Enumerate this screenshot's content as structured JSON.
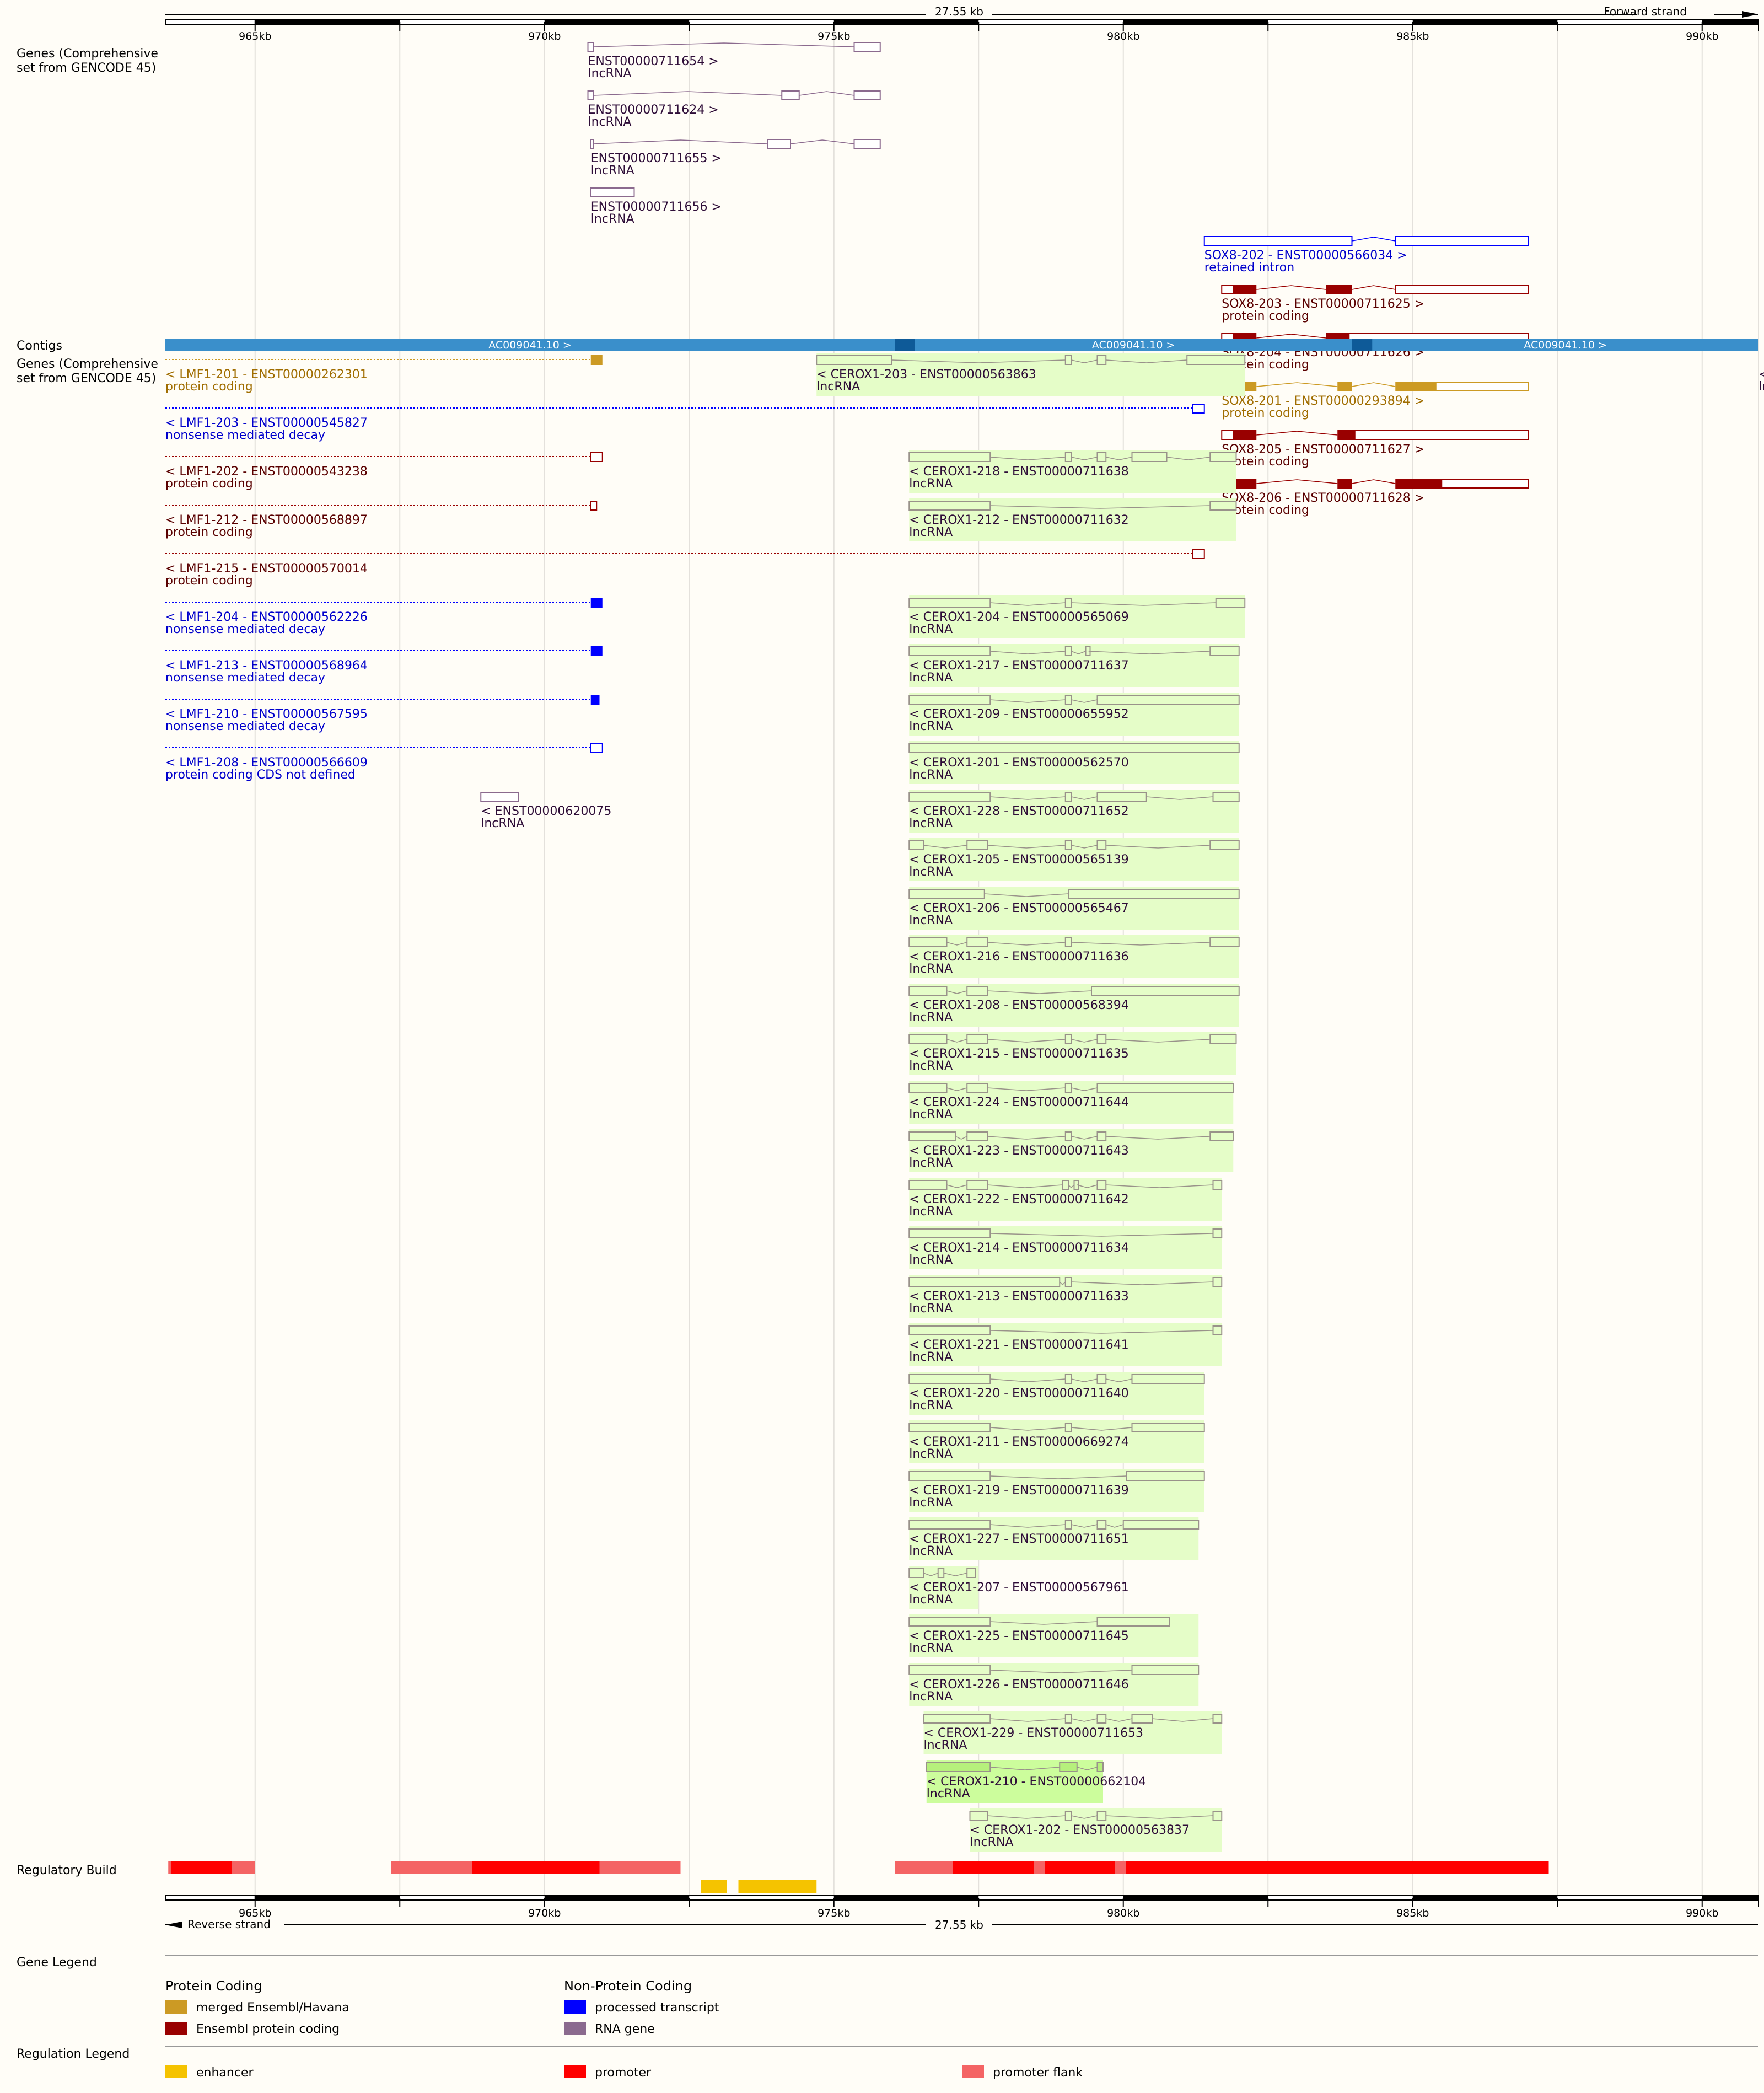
{
  "ruler": {
    "span_label": "27.55 kb",
    "forward_label": "Forward strand",
    "reverse_label": "Reverse strand",
    "ticks": [
      "965kb",
      "970kb",
      "975kb",
      "980kb",
      "985kb",
      "990kb"
    ]
  },
  "tracks": {
    "genes_top": "Genes (Comprehensive set from GENCODE 45)",
    "contigs": "Contigs",
    "genes_bottom": "Genes (Comprehensive set from GENCODE 45)",
    "regulatory": "Regulatory Build",
    "gene_legend": "Gene Legend",
    "regulation_legend": "Regulation Legend"
  },
  "contigs": [
    "AC009041.10 >",
    "AC009041.10 >",
    "AC009041.10 >"
  ],
  "colors": {
    "merged": "#cc9a24",
    "ensembl_coding": "#990000",
    "processed": "#0000ff",
    "rna_gene": "#8b6a8e",
    "lncrna_text": "#2e0d38",
    "contig": "#3a8fcb",
    "contig_dark": "#0e5a98",
    "enhancer": "#f5c300",
    "promoter": "#ff0000",
    "promoter_flank": "#f46464",
    "highlight": "#e5fdc8"
  },
  "genes_forward": [
    {
      "name": "ENST00000711654 >",
      "biotype": "lncRNA",
      "color": "#8b6a8e",
      "text": "#2e0d38",
      "exons": [
        [
          970.75,
          970.85,
          "o"
        ],
        [
          975.35,
          975.8,
          "o"
        ]
      ]
    },
    {
      "name": "ENST00000711624 >",
      "biotype": "lncRNA",
      "color": "#8b6a8e",
      "text": "#2e0d38",
      "exons": [
        [
          970.75,
          970.85,
          "o"
        ],
        [
          974.1,
          974.4,
          "o"
        ],
        [
          975.35,
          975.8,
          "o"
        ]
      ]
    },
    {
      "name": "ENST00000711655 >",
      "biotype": "lncRNA",
      "color": "#8b6a8e",
      "text": "#2e0d38",
      "exons": [
        [
          970.8,
          970.85,
          "o"
        ],
        [
          973.85,
          974.25,
          "o"
        ],
        [
          975.35,
          975.8,
          "o"
        ]
      ]
    },
    {
      "name": "ENST00000711656 >",
      "biotype": "lncRNA",
      "color": "#8b6a8e",
      "text": "#2e0d38",
      "exons": [
        [
          970.8,
          971.55,
          "o"
        ]
      ]
    },
    {
      "name": "SOX8-202 - ENST00000566034 >",
      "biotype": "retained intron",
      "color": "#0000ff",
      "text": "#0000cc",
      "exons": [
        [
          981.4,
          983.95,
          "o"
        ],
        [
          984.7,
          987.0,
          "o"
        ]
      ]
    },
    {
      "name": "SOX8-203 - ENST00000711625 >",
      "biotype": "protein coding",
      "color": "#990000",
      "text": "#5a0000",
      "exons": [
        [
          981.7,
          981.9,
          "o"
        ],
        [
          981.9,
          982.3,
          "f"
        ],
        [
          983.5,
          983.95,
          "f"
        ],
        [
          984.7,
          987.0,
          "o"
        ]
      ]
    },
    {
      "name": "SOX8-204 - ENST00000711626 >",
      "biotype": "protein coding",
      "color": "#990000",
      "text": "#5a0000",
      "exons": [
        [
          981.7,
          981.9,
          "o"
        ],
        [
          981.9,
          982.3,
          "f"
        ],
        [
          983.5,
          983.9,
          "f"
        ],
        [
          983.9,
          987.0,
          "o"
        ]
      ]
    },
    {
      "name": "SOX8-201 - ENST00000293894 >",
      "biotype": "protein coding",
      "color": "#cc9a24",
      "text": "#a06d00",
      "exons": [
        [
          981.7,
          981.9,
          "o"
        ],
        [
          981.9,
          982.3,
          "f"
        ],
        [
          983.7,
          983.95,
          "f"
        ],
        [
          984.7,
          985.4,
          "f"
        ],
        [
          985.4,
          987.0,
          "o"
        ]
      ]
    },
    {
      "name": "SOX8-205 - ENST00000711627 >",
      "biotype": "protein coding",
      "color": "#990000",
      "text": "#5a0000",
      "exons": [
        [
          981.7,
          981.9,
          "o"
        ],
        [
          981.9,
          982.3,
          "f"
        ],
        [
          983.7,
          984.0,
          "f"
        ],
        [
          984.0,
          987.0,
          "o"
        ]
      ]
    },
    {
      "name": "SOX8-206 - ENST00000711628 >",
      "biotype": "protein coding",
      "color": "#990000",
      "text": "#5a0000",
      "exons": [
        [
          981.7,
          981.9,
          "o"
        ],
        [
          981.9,
          982.3,
          "f"
        ],
        [
          983.7,
          983.95,
          "f"
        ],
        [
          984.7,
          985.5,
          "f"
        ],
        [
          985.5,
          987.0,
          "o"
        ]
      ]
    }
  ],
  "lmf1": [
    {
      "name": "< LMF1-201 - ENST00000262301",
      "biotype": "protein coding",
      "color": "#cc9a24",
      "text": "#a06d00",
      "exon": [
        970.8,
        971.0,
        "f"
      ]
    },
    {
      "name": "< LMF1-203 - ENST00000545827",
      "biotype": "nonsense mediated decay",
      "color": "#0000ff",
      "text": "#0000cc",
      "exon": [
        981.2,
        981.4,
        "o"
      ]
    },
    {
      "name": "< LMF1-202 - ENST00000543238",
      "biotype": "protein coding",
      "color": "#990000",
      "text": "#5a0000",
      "exon": [
        970.8,
        971.0,
        "o"
      ]
    },
    {
      "name": "< LMF1-212 - ENST00000568897",
      "biotype": "protein coding",
      "color": "#990000",
      "text": "#5a0000",
      "exon": [
        970.8,
        970.9,
        "o"
      ]
    },
    {
      "name": "< LMF1-215 - ENST00000570014",
      "biotype": "protein coding",
      "color": "#990000",
      "text": "#5a0000",
      "exon": [
        981.2,
        981.4,
        "o"
      ]
    },
    {
      "name": "< LMF1-204 - ENST00000562226",
      "biotype": "nonsense mediated decay",
      "color": "#0000ff",
      "text": "#0000cc",
      "exon": [
        970.8,
        971.0,
        "f"
      ]
    },
    {
      "name": "< LMF1-213 - ENST00000568964",
      "biotype": "nonsense mediated decay",
      "color": "#0000ff",
      "text": "#0000cc",
      "exon": [
        970.8,
        971.0,
        "f"
      ]
    },
    {
      "name": "< LMF1-210 - ENST00000567595",
      "biotype": "nonsense mediated decay",
      "color": "#0000ff",
      "text": "#0000cc",
      "exon": [
        970.8,
        970.95,
        "f"
      ]
    },
    {
      "name": "< LMF1-208 - ENST00000566609",
      "biotype": "protein coding CDS not defined",
      "color": "#0000ff",
      "text": "#0000cc",
      "exon": [
        970.8,
        971.0,
        "o"
      ]
    }
  ],
  "misc_reverse": [
    {
      "name": "< ENST00000620075",
      "biotype": "lncRNA",
      "row": 9,
      "start": 968.9,
      "end": 969.55
    },
    {
      "name": "< ENST",
      "biotype": "lncRNA",
      "row": 0,
      "start": 991.05,
      "end": 991.6
    }
  ],
  "cerox1": [
    {
      "name": "< CEROX1-203 - ENST00000563863",
      "biotype": "lncRNA",
      "row": 0,
      "start": 974.7,
      "end": 982.1,
      "exons": [
        [
          974.7,
          976.0
        ],
        [
          979.0,
          979.1
        ],
        [
          979.55,
          979.7
        ],
        [
          981.1,
          982.1
        ]
      ]
    },
    {
      "name": "< CEROX1-218 - ENST00000711638",
      "biotype": "lncRNA",
      "row": 2,
      "start": 976.3,
      "end": 981.95,
      "exons": [
        [
          976.3,
          977.7
        ],
        [
          979.0,
          979.1
        ],
        [
          979.55,
          979.7
        ],
        [
          980.15,
          980.75
        ],
        [
          981.5,
          981.95
        ]
      ]
    },
    {
      "name": "< CEROX1-212 - ENST00000711632",
      "biotype": "lncRNA",
      "row": 3,
      "start": 976.3,
      "end": 981.95,
      "exons": [
        [
          976.3,
          977.7
        ],
        [
          981.5,
          981.95
        ]
      ]
    },
    {
      "name": "< CEROX1-204 - ENST00000565069",
      "biotype": "lncRNA",
      "row": 5,
      "start": 976.3,
      "end": 982.1,
      "exons": [
        [
          976.3,
          977.7
        ],
        [
          979.0,
          979.1
        ],
        [
          981.6,
          982.1
        ]
      ]
    },
    {
      "name": "< CEROX1-217 - ENST00000711637",
      "biotype": "lncRNA",
      "row": 6,
      "start": 976.3,
      "end": 982.0,
      "exons": [
        [
          976.3,
          977.7
        ],
        [
          979.0,
          979.1
        ],
        [
          979.35,
          979.4
        ],
        [
          981.5,
          982.0
        ]
      ]
    },
    {
      "name": "< CEROX1-209 - ENST00000655952",
      "biotype": "lncRNA",
      "row": 7,
      "start": 976.3,
      "end": 982.0,
      "exons": [
        [
          976.3,
          977.7
        ],
        [
          979.0,
          979.1
        ],
        [
          979.55,
          982.0
        ]
      ]
    },
    {
      "name": "< CEROX1-201 - ENST00000562570",
      "biotype": "lncRNA",
      "row": 8,
      "start": 976.3,
      "end": 982.0,
      "exons": [
        [
          976.3,
          982.0
        ]
      ]
    },
    {
      "name": "< CEROX1-228 - ENST00000711652",
      "biotype": "lncRNA",
      "row": 9,
      "start": 976.3,
      "end": 982.0,
      "exons": [
        [
          976.3,
          977.7
        ],
        [
          979.0,
          979.1
        ],
        [
          979.55,
          980.4
        ],
        [
          981.55,
          982.0
        ]
      ]
    },
    {
      "name": "< CEROX1-205 - ENST00000565139",
      "biotype": "lncRNA",
      "row": 10,
      "start": 976.3,
      "end": 982.0,
      "exons": [
        [
          976.3,
          976.55
        ],
        [
          977.3,
          977.65
        ],
        [
          979.0,
          979.1
        ],
        [
          979.55,
          979.7
        ],
        [
          981.5,
          982.0
        ]
      ]
    },
    {
      "name": "< CEROX1-206 - ENST00000565467",
      "biotype": "lncRNA",
      "row": 11,
      "start": 976.3,
      "end": 982.0,
      "exons": [
        [
          976.3,
          977.6
        ],
        [
          979.05,
          982.0
        ]
      ]
    },
    {
      "name": "< CEROX1-216 - ENST00000711636",
      "biotype": "lncRNA",
      "row": 12,
      "start": 976.3,
      "end": 982.0,
      "exons": [
        [
          976.3,
          976.95
        ],
        [
          977.3,
          977.65
        ],
        [
          979.0,
          979.1
        ],
        [
          981.5,
          982.0
        ]
      ]
    },
    {
      "name": "< CEROX1-208 - ENST00000568394",
      "biotype": "lncRNA",
      "row": 13,
      "start": 976.3,
      "end": 982.0,
      "exons": [
        [
          976.3,
          976.95
        ],
        [
          977.3,
          977.65
        ],
        [
          979.45,
          982.0
        ]
      ]
    },
    {
      "name": "< CEROX1-215 - ENST00000711635",
      "biotype": "lncRNA",
      "row": 14,
      "start": 976.3,
      "end": 981.95,
      "exons": [
        [
          976.3,
          976.95
        ],
        [
          977.3,
          977.65
        ],
        [
          979.0,
          979.1
        ],
        [
          979.55,
          979.7
        ],
        [
          981.5,
          981.95
        ]
      ]
    },
    {
      "name": "< CEROX1-224 - ENST00000711644",
      "biotype": "lncRNA",
      "row": 15,
      "start": 976.3,
      "end": 981.9,
      "exons": [
        [
          976.3,
          976.95
        ],
        [
          977.3,
          977.65
        ],
        [
          979.0,
          979.1
        ],
        [
          979.55,
          981.9
        ]
      ]
    },
    {
      "name": "< CEROX1-223 - ENST00000711643",
      "biotype": "lncRNA",
      "row": 16,
      "start": 976.3,
      "end": 981.9,
      "exons": [
        [
          976.3,
          977.1
        ],
        [
          977.3,
          977.65
        ],
        [
          979.0,
          979.1
        ],
        [
          979.55,
          979.7
        ],
        [
          981.5,
          981.9
        ]
      ]
    },
    {
      "name": "< CEROX1-222 - ENST00000711642",
      "biotype": "lncRNA",
      "row": 17,
      "start": 976.3,
      "end": 981.7,
      "exons": [
        [
          976.3,
          976.95
        ],
        [
          977.3,
          977.65
        ],
        [
          978.95,
          979.05
        ],
        [
          979.15,
          979.2
        ],
        [
          979.55,
          979.7
        ],
        [
          981.55,
          981.7
        ]
      ]
    },
    {
      "name": "< CEROX1-214 - ENST00000711634",
      "biotype": "lncRNA",
      "row": 18,
      "start": 976.3,
      "end": 981.7,
      "exons": [
        [
          976.3,
          977.7
        ],
        [
          981.55,
          981.7
        ]
      ]
    },
    {
      "name": "< CEROX1-213 - ENST00000711633",
      "biotype": "lncRNA",
      "row": 19,
      "start": 976.3,
      "end": 981.7,
      "exons": [
        [
          976.3,
          978.9
        ],
        [
          979.0,
          979.1
        ],
        [
          981.55,
          981.7
        ]
      ]
    },
    {
      "name": "< CEROX1-221 - ENST00000711641",
      "biotype": "lncRNA",
      "row": 20,
      "start": 976.3,
      "end": 981.7,
      "exons": [
        [
          976.3,
          977.7
        ],
        [
          981.55,
          981.7
        ]
      ]
    },
    {
      "name": "< CEROX1-220 - ENST00000711640",
      "biotype": "lncRNA",
      "row": 21,
      "start": 976.3,
      "end": 981.4,
      "exons": [
        [
          976.3,
          977.7
        ],
        [
          979.0,
          979.1
        ],
        [
          979.55,
          979.7
        ],
        [
          980.15,
          981.4
        ]
      ]
    },
    {
      "name": "< CEROX1-211 - ENST00000669274",
      "biotype": "lncRNA",
      "row": 22,
      "start": 976.3,
      "end": 981.4,
      "exons": [
        [
          976.3,
          977.7
        ],
        [
          979.0,
          979.1
        ],
        [
          980.15,
          981.4
        ]
      ]
    },
    {
      "name": "< CEROX1-219 - ENST00000711639",
      "biotype": "lncRNA",
      "row": 23,
      "start": 976.3,
      "end": 981.4,
      "exons": [
        [
          976.3,
          977.7
        ],
        [
          980.05,
          981.4
        ]
      ]
    },
    {
      "name": "< CEROX1-227 - ENST00000711651",
      "biotype": "lncRNA",
      "row": 24,
      "start": 976.3,
      "end": 981.3,
      "exons": [
        [
          976.3,
          977.7
        ],
        [
          979.0,
          979.1
        ],
        [
          979.55,
          979.7
        ],
        [
          980.0,
          981.3
        ]
      ]
    },
    {
      "name": "< CEROX1-207 - ENST00000567961",
      "biotype": "lncRNA",
      "row": 25,
      "start": 976.3,
      "end": 977.5,
      "exons": [
        [
          976.3,
          976.55
        ],
        [
          976.8,
          976.9
        ],
        [
          977.3,
          977.45
        ]
      ]
    },
    {
      "name": "< CEROX1-225 - ENST00000711645",
      "biotype": "lncRNA",
      "row": 26,
      "start": 976.3,
      "end": 981.3,
      "exons": [
        [
          976.3,
          977.7
        ],
        [
          979.55,
          980.8
        ]
      ]
    },
    {
      "name": "< CEROX1-226 - ENST00000711646",
      "biotype": "lncRNA",
      "row": 27,
      "start": 976.3,
      "end": 981.3,
      "exons": [
        [
          976.3,
          977.7
        ],
        [
          980.15,
          981.3
        ]
      ]
    },
    {
      "name": "< CEROX1-229 - ENST00000711653",
      "biotype": "lncRNA",
      "row": 28,
      "start": 976.55,
      "end": 981.7,
      "exons": [
        [
          976.55,
          977.7
        ],
        [
          979.0,
          979.1
        ],
        [
          979.55,
          979.7
        ],
        [
          980.15,
          980.5
        ],
        [
          981.55,
          981.7
        ]
      ]
    },
    {
      "name": "< CEROX1-210 - ENST00000662104",
      "biotype": "lncRNA",
      "row": 29,
      "start": 976.6,
      "end": 979.65,
      "exons": [
        [
          976.6,
          977.7
        ],
        [
          978.9,
          979.2
        ],
        [
          979.55,
          979.65
        ]
      ]
    },
    {
      "name": "< CEROX1-202 - ENST00000563837",
      "biotype": "lncRNA",
      "row": 30,
      "start": 977.35,
      "end": 981.7,
      "exons": [
        [
          977.35,
          977.65
        ],
        [
          979.0,
          979.1
        ],
        [
          979.55,
          979.7
        ],
        [
          981.55,
          981.7
        ]
      ]
    }
  ],
  "regulatory": [
    {
      "type": "promoter_flank",
      "start": 963.5,
      "end": 965.0
    },
    {
      "type": "promoter",
      "start": 963.55,
      "end": 964.6
    },
    {
      "type": "promoter_flank",
      "start": 967.35,
      "end": 972.35
    },
    {
      "type": "promoter",
      "start": 968.75,
      "end": 970.95
    },
    {
      "type": "promoter_flank",
      "start": 976.05,
      "end": 987.35
    },
    {
      "type": "promoter",
      "start": 977.05,
      "end": 978.45
    },
    {
      "type": "promoter",
      "start": 978.65,
      "end": 979.85
    },
    {
      "type": "promoter",
      "start": 980.05,
      "end": 987.35
    },
    {
      "type": "enhancer",
      "start": 972.7,
      "end": 973.15
    },
    {
      "type": "enhancer",
      "start": 973.35,
      "end": 974.7
    }
  ],
  "legend": {
    "protein_coding_title": "Protein Coding",
    "non_protein_title": "Non-Protein Coding",
    "merged": "merged Ensembl/Havana",
    "ensembl_coding": "Ensembl protein coding",
    "processed": "processed transcript",
    "rna_gene": "RNA gene",
    "enhancer": "enhancer",
    "promoter": "promoter",
    "promoter_flank": "promoter flank"
  }
}
